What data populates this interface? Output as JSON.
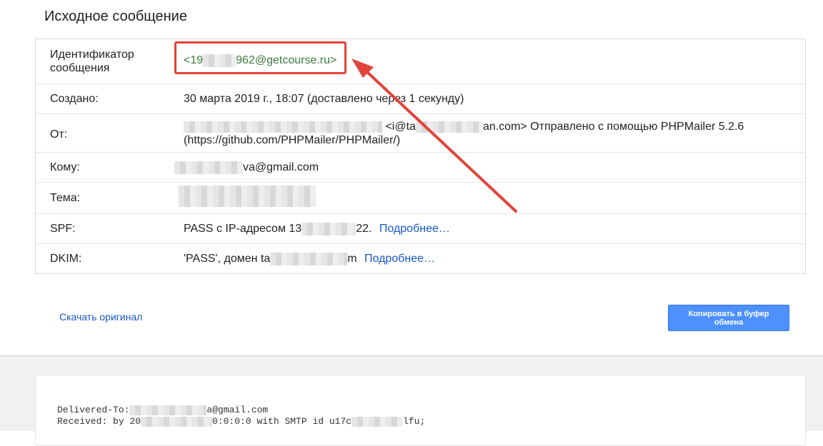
{
  "page": {
    "title": "Исходное сообщение"
  },
  "details": {
    "message_id": {
      "label": "Идентификатор сообщения",
      "prefix": "<19",
      "suffix": "962@getcourse.ru>"
    },
    "created": {
      "label": "Создано:",
      "value": "30 марта 2019 г., 18:07 (доставлено через 1 секунду)"
    },
    "from": {
      "label": "От:",
      "value": "<i@ta",
      "value_2": "an.com> Отправлено с помощью PHPMailer 5.2.6",
      "value_3": "(https://github.com/PHPMailer/PHPMailer/)"
    },
    "to": {
      "label": "Кому:",
      "value": "va@gmail.com"
    },
    "subject": {
      "label": "Тема:"
    },
    "spf": {
      "label": "SPF:",
      "value_prefix": "PASS с IP-адресом 13",
      "value_suffix": "22.",
      "more_link": "Подробнее…"
    },
    "dkim": {
      "label": "DKIM:",
      "value_prefix": "'PASS', домен ta",
      "value_suffix": "m",
      "more_link": "Подробнее…"
    }
  },
  "actions": {
    "download_label": "Скачать оригинал",
    "copy_label": "Копировать в буфер обмена"
  },
  "raw": {
    "line1_prefix": "Delivered-To:",
    "line1_suffix": "a@gmail.com",
    "line2_prefix": "Received: by 20",
    "line2_mid": "0:0:0:0 with SMTP id u17c",
    "line2_suffix": "lfu;"
  },
  "annotation": {
    "color": "#e0443a"
  }
}
